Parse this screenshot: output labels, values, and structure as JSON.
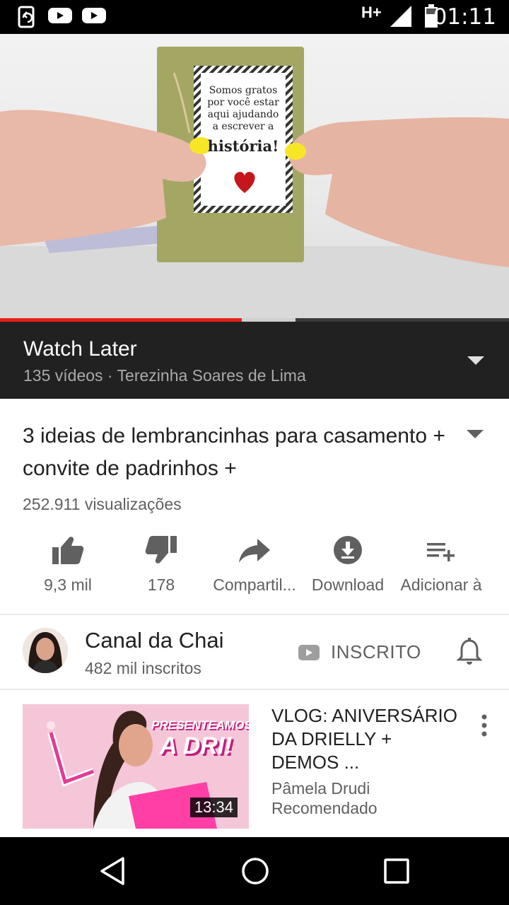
{
  "status_bar": {
    "time": "01:11",
    "network": "H+",
    "icons": [
      "screen-mirror-icon",
      "youtube-notification-icon",
      "youtube-notification-icon",
      "signal-icon",
      "battery-icon"
    ]
  },
  "player": {
    "progress_played": 0.475,
    "progress_buffered": 0.58
  },
  "playlist": {
    "title": "Watch Later",
    "subtitle": "135 vídeos · Terezinha Soares de Lima"
  },
  "video": {
    "title": "3 ideias de lembrancinhas para casamento + convite de padrinhos +",
    "views": "252.911 visualizações"
  },
  "actions": [
    {
      "icon": "thumbs-up-icon",
      "label": "9,3 mil"
    },
    {
      "icon": "thumbs-down-icon",
      "label": "178"
    },
    {
      "icon": "share-icon",
      "label": "Compartil..."
    },
    {
      "icon": "download-icon",
      "label": "Download"
    },
    {
      "icon": "add-to-playlist-icon",
      "label": "Adicionar à"
    }
  ],
  "channel": {
    "name": "Canal da Chai",
    "subscribers": "482 mil inscritos",
    "subscribe_label": "INSCRITO"
  },
  "recommended": [
    {
      "title": "VLOG: ANIVERSÁRIO DA DRIELLY + DEMOS ...",
      "channel": "Pâmela Drudi",
      "note": "Recomendado",
      "duration": "13:34",
      "thumb_text": [
        "PRESENTEAMOS",
        "A DRI!"
      ]
    }
  ],
  "video_frame_text": [
    "Somos gratos",
    "por você estar",
    "aqui ajudando",
    "a escrever a",
    "história!"
  ],
  "colors": {
    "accent": "#e62117",
    "playlist_bg": "#212121",
    "text_primary": "#212121",
    "text_secondary": "#606060"
  }
}
